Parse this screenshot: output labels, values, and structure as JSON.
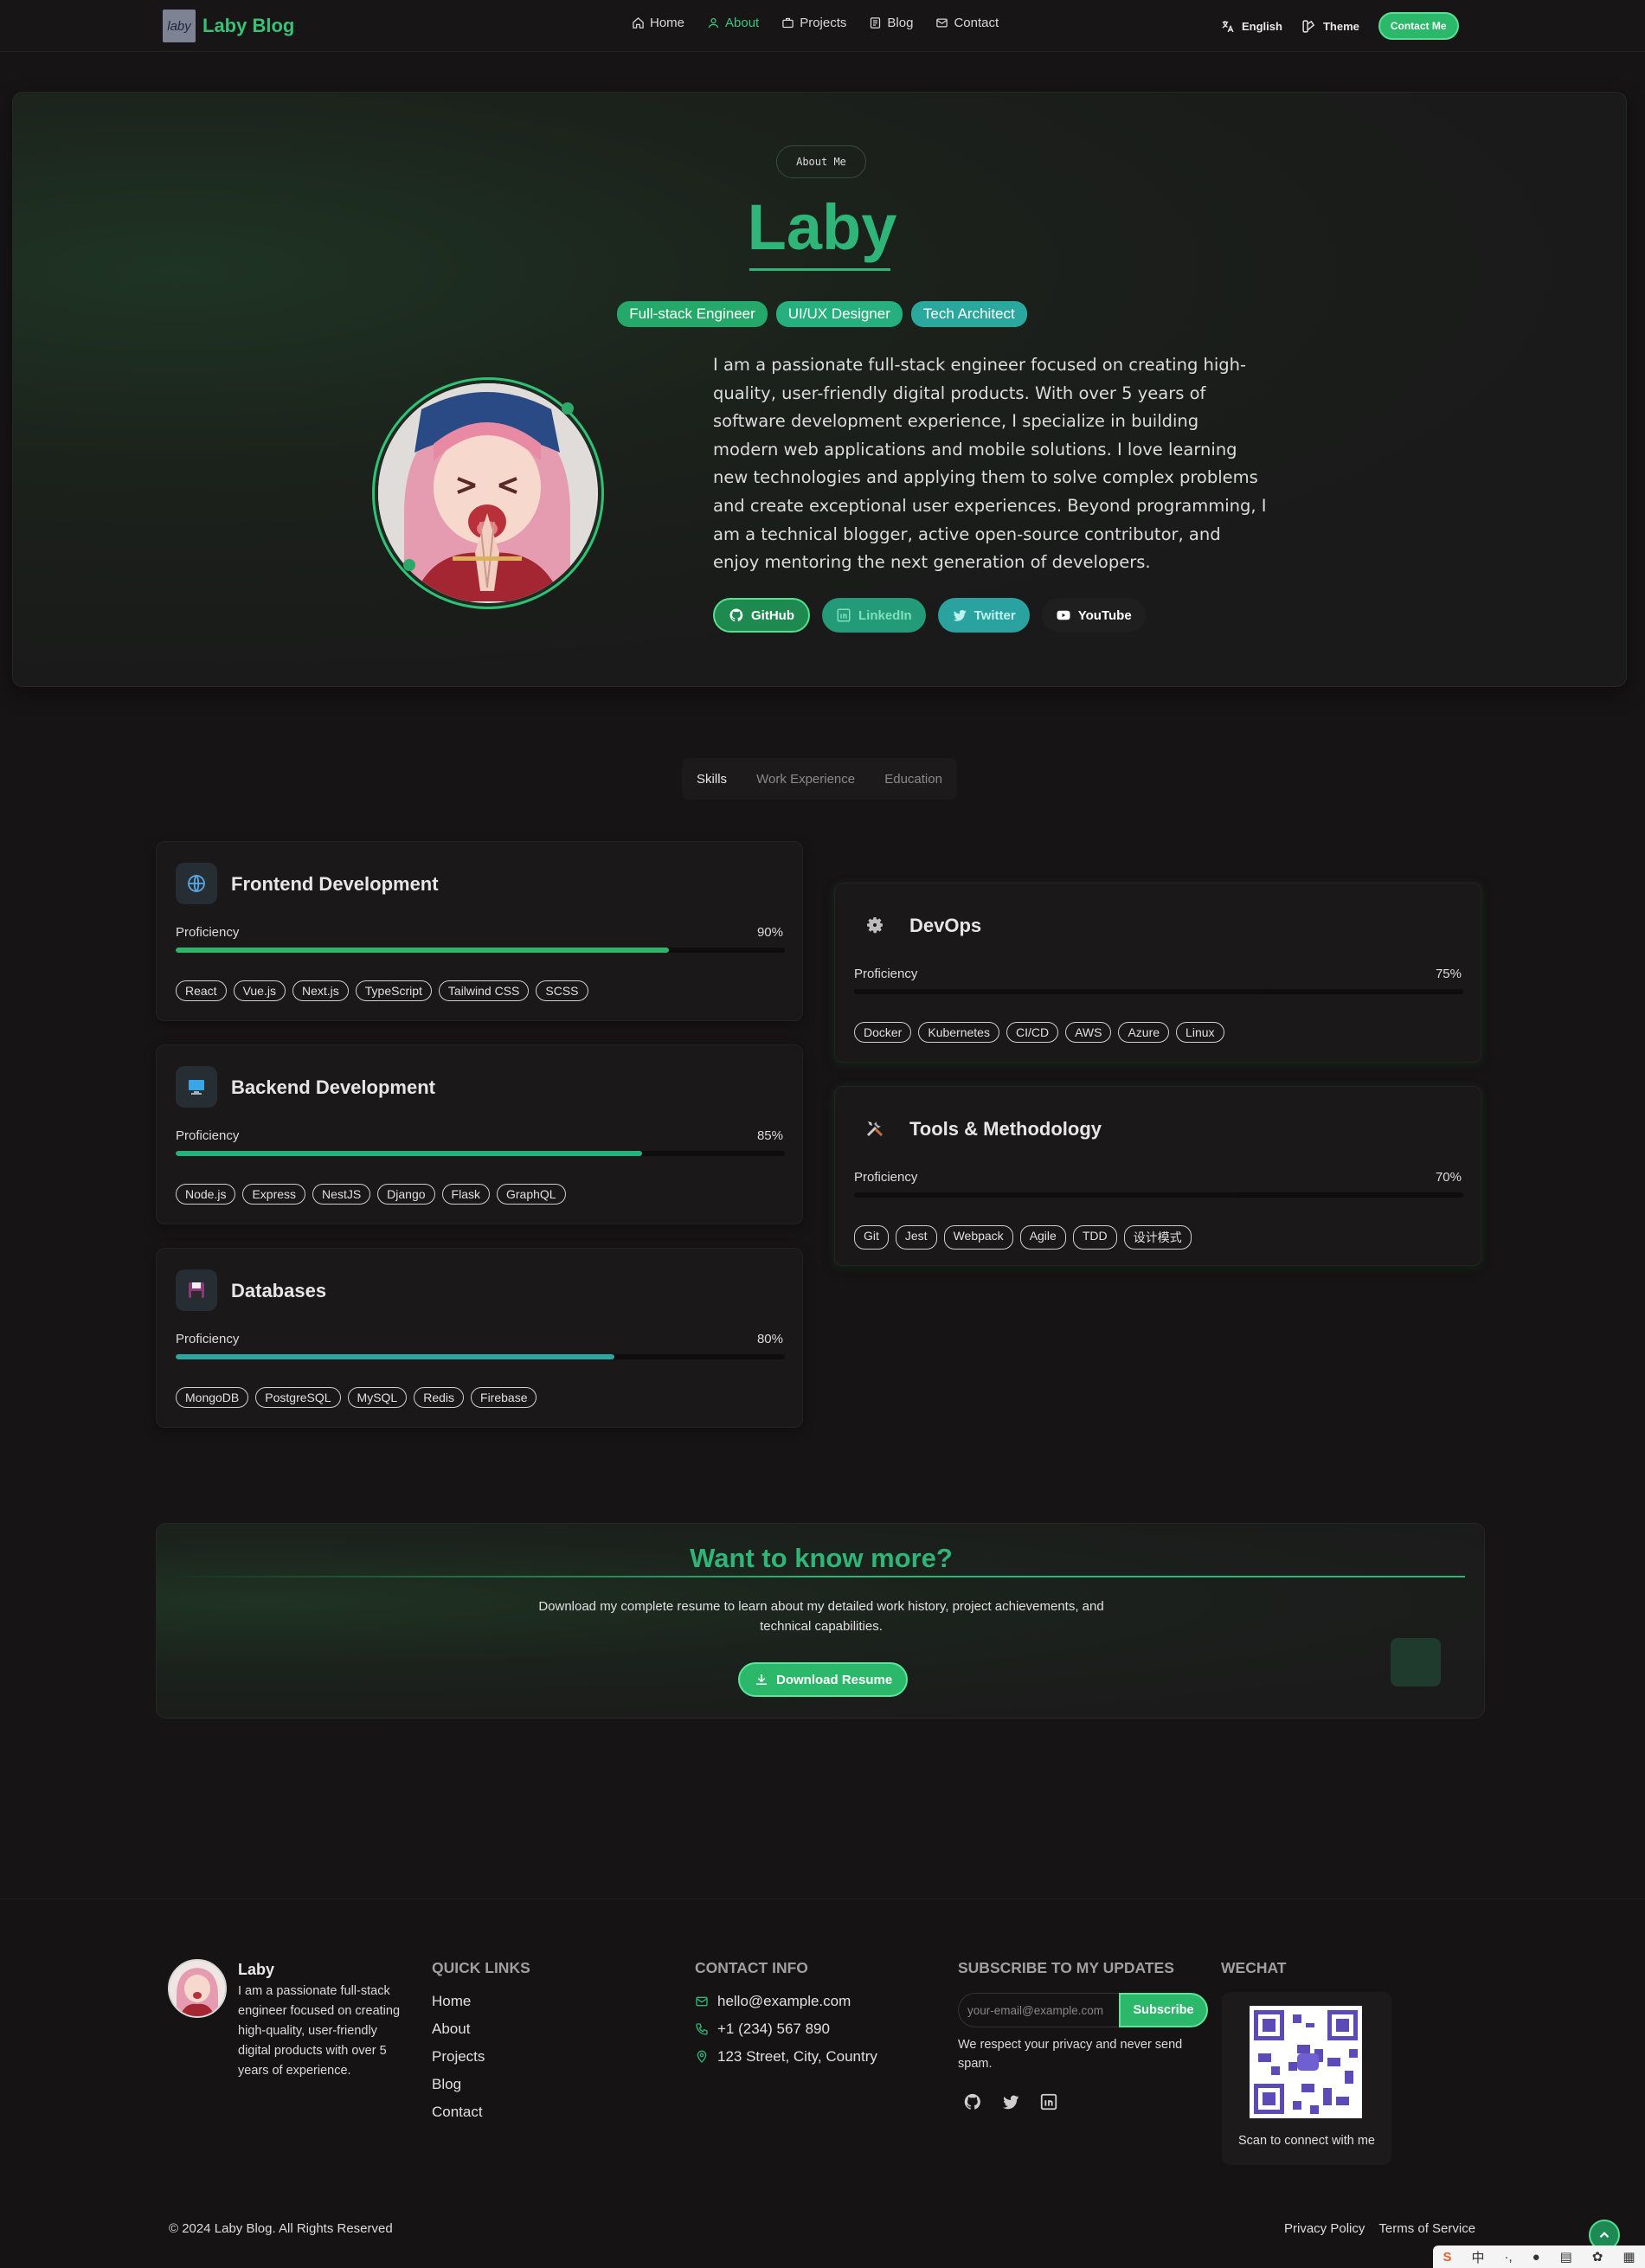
{
  "nav": {
    "logo_text": "laby",
    "brand": "Laby Blog",
    "links": [
      "Home",
      "About",
      "Projects",
      "Blog",
      "Contact"
    ],
    "active": "About",
    "language": "English",
    "theme": "Theme",
    "contact_button": "Contact Me"
  },
  "hero": {
    "pill": "About Me",
    "name": "Laby",
    "roles": [
      "Full-stack Engineer",
      "UI/UX Designer",
      "Tech Architect"
    ],
    "bio": "I am a passionate full-stack engineer focused on creating high-quality, user-friendly digital products. With over 5 years of software development experience, I specialize in building modern web applications and mobile solutions. I love learning new technologies and applying them to solve complex problems and create exceptional user experiences. Beyond programming, I am a technical blogger, active open-source contributor, and enjoy mentoring the next generation of developers.",
    "socials": [
      "GitHub",
      "LinkedIn",
      "Twitter",
      "YouTube"
    ]
  },
  "tabs": {
    "items": [
      "Skills",
      "Work Experience",
      "Education"
    ],
    "active": "Skills"
  },
  "skills": {
    "proficiency_label": "Proficiency",
    "cards": [
      {
        "title": "Frontend Development",
        "icon": "globe-icon",
        "percent": "90%",
        "level": 0.9,
        "color": "#2cb86a",
        "tags": [
          "React",
          "Vue.js",
          "Next.js",
          "TypeScript",
          "Tailwind CSS",
          "SCSS"
        ]
      },
      {
        "title": "Backend Development",
        "icon": "monitor-icon",
        "percent": "85%",
        "level": 0.85,
        "color": "#26b07f",
        "tags": [
          "Node.js",
          "Express",
          "NestJS",
          "Django",
          "Flask",
          "GraphQL"
        ]
      },
      {
        "title": "Databases",
        "icon": "floppy-disk-icon",
        "percent": "80%",
        "level": 0.8,
        "color": "#2aa8a0",
        "tags": [
          "MongoDB",
          "PostgreSQL",
          "MySQL",
          "Redis",
          "Firebase"
        ]
      },
      {
        "title": "DevOps",
        "icon": "gear-icon",
        "percent": "75%",
        "level": 0.75,
        "color": "#0f0d0e",
        "tags": [
          "Docker",
          "Kubernetes",
          "CI/CD",
          "AWS",
          "Azure",
          "Linux"
        ]
      },
      {
        "title": "Tools & Methodology",
        "icon": "tools-icon",
        "percent": "70%",
        "level": 0.7,
        "color": "#0f0d0e",
        "tags": [
          "Git",
          "Jest",
          "Webpack",
          "Agile",
          "TDD",
          "设计模式"
        ]
      }
    ]
  },
  "cta": {
    "title": "Want to know more?",
    "text": "Download my complete resume to learn about my detailed work history, project achievements, and technical capabilities.",
    "button": "Download Resume"
  },
  "footer": {
    "name": "Laby",
    "bio": "I am a passionate full-stack engineer focused on creating high-quality, user-friendly digital products with over 5 years of experience.",
    "quick_links_title": "QUICK LINKS",
    "quick_links": [
      "Home",
      "About",
      "Projects",
      "Blog",
      "Contact"
    ],
    "contact_title": "CONTACT INFO",
    "email": "hello@example.com",
    "phone": "+1 (234) 567 890",
    "address": "123 Street, City, Country",
    "subscribe_title": "SUBSCRIBE TO MY UPDATES",
    "subscribe_placeholder": "your-email@example.com",
    "subscribe_button": "Subscribe",
    "subscribe_note": "We respect your privacy and never send spam.",
    "wechat_title": "WECHAT",
    "wechat_caption": "Scan to connect with me",
    "copyright": "© 2024 Laby Blog. All Rights Reserved",
    "legal": [
      "Privacy Policy",
      "Terms of Service"
    ]
  },
  "ime_bar": {
    "items": [
      "S",
      "中"
    ]
  }
}
